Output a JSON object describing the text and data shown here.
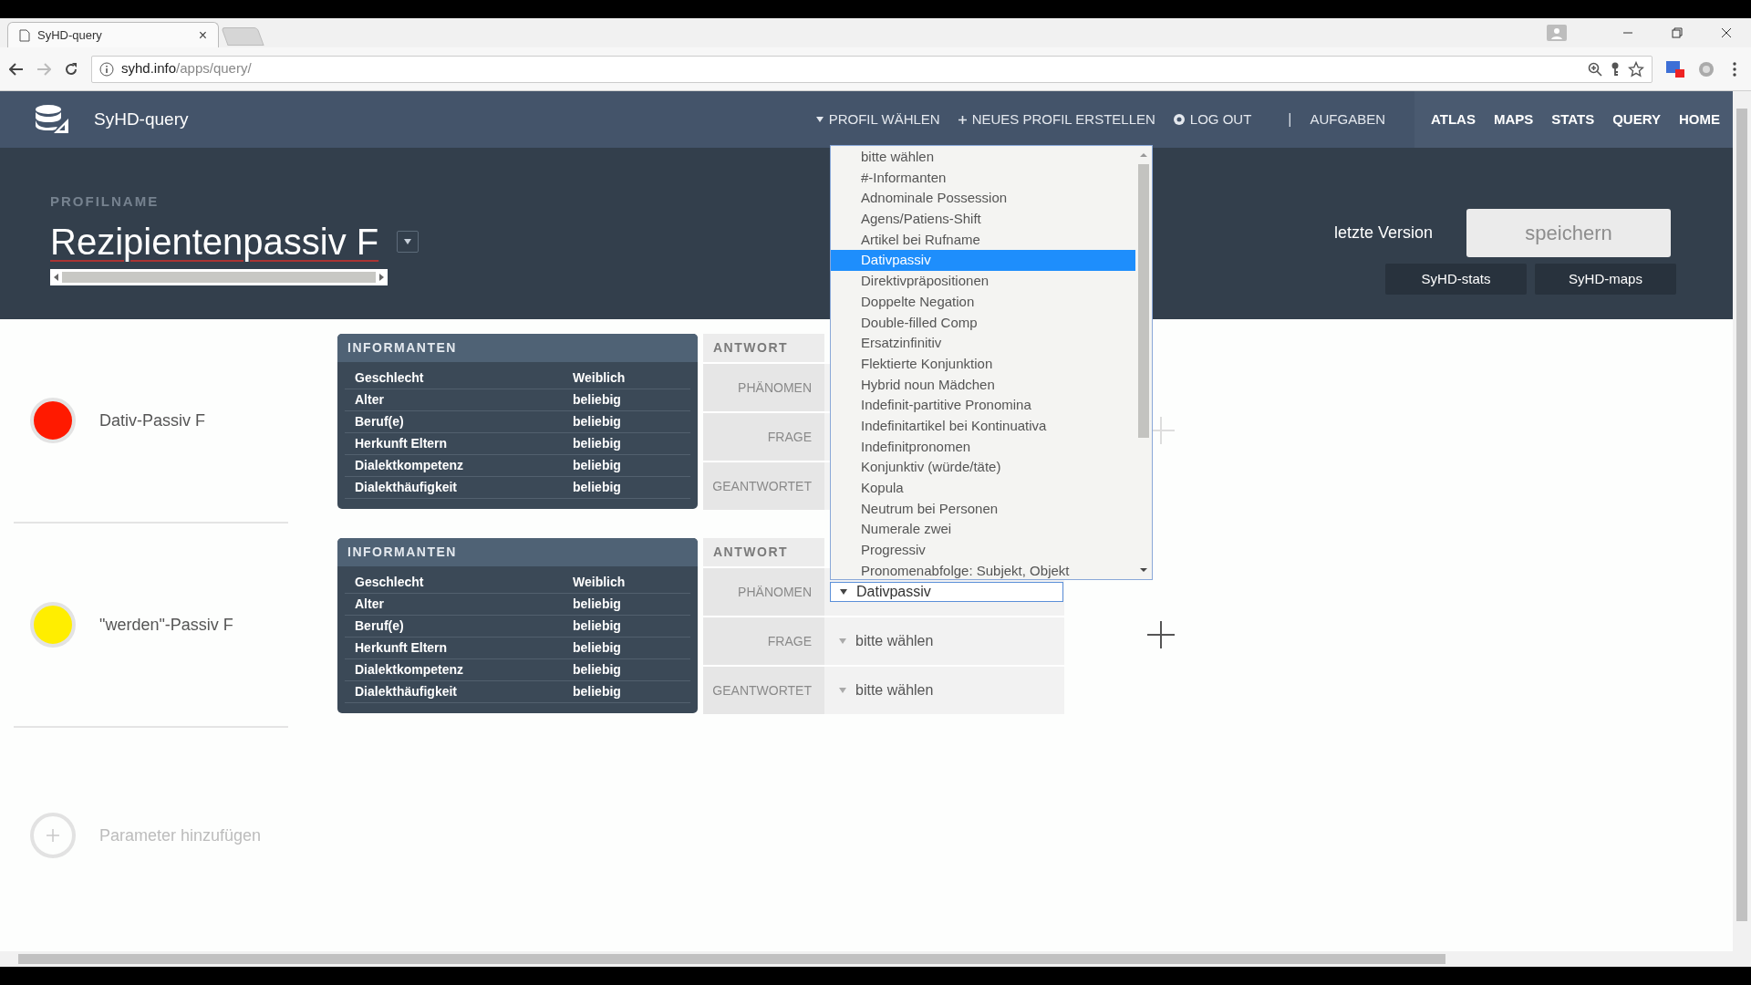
{
  "browser": {
    "tab_title": "SyHD-query",
    "tab_close": "×",
    "url_host": "syhd.info",
    "url_path": "/apps/query/"
  },
  "navbar": {
    "app_title": "SyHD-query",
    "menu": [
      {
        "label": "PROFIL WÄHLEN",
        "kind": "dropdown"
      },
      {
        "label": "NEUES PROFIL ERSTELLEN",
        "kind": "add"
      },
      {
        "label": "LOG OUT",
        "kind": "logout"
      },
      {
        "label": "|",
        "kind": "separator"
      },
      {
        "label": "AUFGABEN",
        "kind": "plain"
      }
    ],
    "links": [
      "ATLAS",
      "MAPS",
      "STATS",
      "QUERY",
      "HOME"
    ]
  },
  "profile": {
    "label": "PROFILNAME",
    "name": "Rezipientenpassiv F",
    "version_label": "letzte Version",
    "save_button": "speichern",
    "buttons": [
      "SyHD-stats",
      "SyHD-maps"
    ]
  },
  "parameters": [
    {
      "name": "Dativ-Passiv F",
      "color": "#ff1a00",
      "informanten": {
        "title": "INFORMANTEN",
        "rows": [
          {
            "label": "Geschlecht",
            "value": "Weiblich"
          },
          {
            "label": "Alter",
            "value": "beliebig"
          },
          {
            "label": "Beruf(e)",
            "value": "beliebig"
          },
          {
            "label": "Herkunft Eltern",
            "value": "beliebig"
          },
          {
            "label": "Dialektkompetenz",
            "value": "beliebig"
          },
          {
            "label": "Dialekthäufigkeit",
            "value": "beliebig"
          }
        ]
      },
      "antwort": {
        "title": "ANTWORT",
        "fields": [
          {
            "label": "PHÄNOMEN"
          },
          {
            "label": "FRAGE"
          },
          {
            "label": "GEANTWORTET"
          }
        ]
      }
    },
    {
      "name": "\"werden\"-Passiv F",
      "color": "#ffee00",
      "informanten": {
        "title": "INFORMANTEN",
        "rows": [
          {
            "label": "Geschlecht",
            "value": "Weiblich"
          },
          {
            "label": "Alter",
            "value": "beliebig"
          },
          {
            "label": "Beruf(e)",
            "value": "beliebig"
          },
          {
            "label": "Herkunft Eltern",
            "value": "beliebig"
          },
          {
            "label": "Dialektkompetenz",
            "value": "beliebig"
          },
          {
            "label": "Dialekthäufigkeit",
            "value": "beliebig"
          }
        ]
      },
      "antwort": {
        "title": "ANTWORT",
        "fields": [
          {
            "label": "PHÄNOMEN",
            "value": "Dativpassiv",
            "focused": true
          },
          {
            "label": "FRAGE",
            "value": "bitte wählen",
            "focused": false
          },
          {
            "label": "GEANTWORTET",
            "value": "bitte wählen",
            "focused": false
          }
        ]
      }
    }
  ],
  "add_parameter": "Parameter hinzufügen",
  "dropdown": {
    "options": [
      {
        "label": "bitte wählen",
        "selected": false
      },
      {
        "label": "#-Informanten",
        "selected": false
      },
      {
        "label": "Adnominale Possession",
        "selected": false
      },
      {
        "label": "Agens/Patiens-Shift",
        "selected": false
      },
      {
        "label": "Artikel bei Rufname",
        "selected": false
      },
      {
        "label": "Dativpassiv",
        "selected": true
      },
      {
        "label": "Direktivpräpositionen",
        "selected": false
      },
      {
        "label": "Doppelte Negation",
        "selected": false
      },
      {
        "label": "Double-filled Comp",
        "selected": false
      },
      {
        "label": "Ersatzinfinitiv",
        "selected": false
      },
      {
        "label": "Flektierte Konjunktion",
        "selected": false
      },
      {
        "label": "Hybrid noun Mädchen",
        "selected": false
      },
      {
        "label": "Indefinit-partitive Pronomina",
        "selected": false
      },
      {
        "label": "Indefinitartikel bei Kontinuativa",
        "selected": false
      },
      {
        "label": "Indefinitpronomen",
        "selected": false
      },
      {
        "label": "Konjunktiv (würde/täte)",
        "selected": false
      },
      {
        "label": "Kopula",
        "selected": false
      },
      {
        "label": "Neutrum bei Personen",
        "selected": false
      },
      {
        "label": "Numerale zwei",
        "selected": false
      },
      {
        "label": "Progressiv",
        "selected": false
      },
      {
        "label": "Pronomenabfolge: Subjekt, Objekt",
        "selected": false
      }
    ]
  }
}
